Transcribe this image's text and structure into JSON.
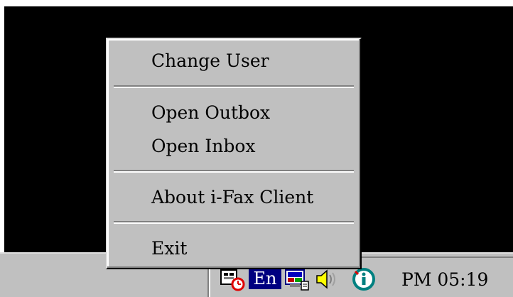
{
  "context_menu": {
    "items": [
      {
        "label": "Change User"
      },
      {
        "label": "Open Outbox"
      },
      {
        "label": "Open Inbox"
      },
      {
        "label": "About i-Fax Client"
      },
      {
        "label": "Exit"
      }
    ]
  },
  "tray": {
    "language_indicator": "En",
    "clock": "PM 05:19",
    "icons": [
      "fax-status-icon",
      "language-icon",
      "display-properties-icon",
      "volume-icon",
      "i-fax-client-icon"
    ]
  },
  "colors": {
    "desktop": "#000000",
    "menu_face": "#c0c0c0",
    "language_badge": "#000080",
    "fax_icon_ring": "#008080"
  }
}
